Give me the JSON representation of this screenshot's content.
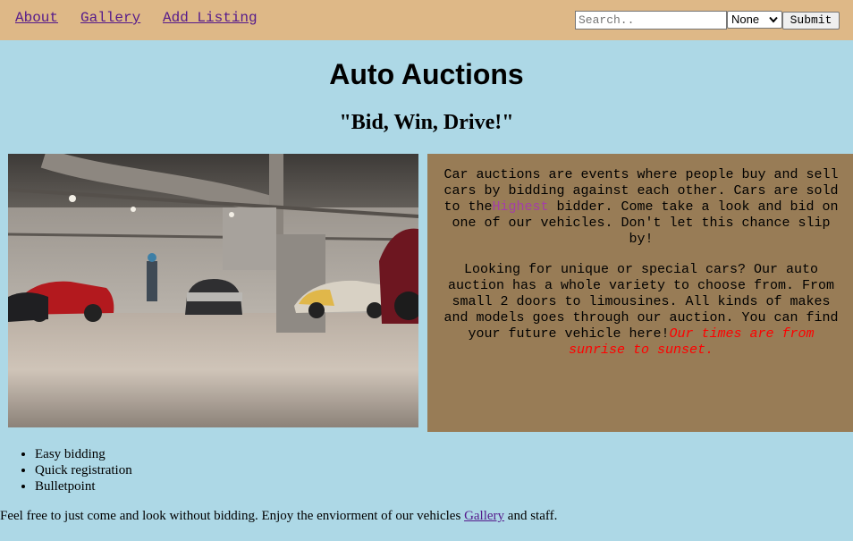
{
  "nav": {
    "links": [
      "About",
      "Gallery",
      "Add Listing"
    ],
    "search_placeholder": "Search..",
    "filter_value": "None",
    "submit_label": "Submit"
  },
  "header": {
    "title": "Auto Auctions",
    "tagline": "\"Bid, Win, Drive!\""
  },
  "hero": {
    "icon": "car-showroom-photo"
  },
  "info": {
    "p1_before": "Car auctions are events where people buy and sell cars by bidding against each other. Cars are sold to the",
    "p1_highlight": "Highest",
    "p1_after": " bidder. Come take a look and bid on one of our vehicles. Don't let this chance slip by!",
    "p2_text": "Looking for unique or special cars? Our auto auction has a whole variety to choose from. From small 2 doors to limousines. All kinds of makes and models goes through our auction. You can find your future vehicle here!",
    "p2_red": "Our times are from sunrise to sunset."
  },
  "features": [
    "Easy bidding",
    "Quick registration",
    "Bulletpoint"
  ],
  "footer": {
    "before": "Feel free to just come and look without bidding. Enjoy the enviorment of our vehicles ",
    "link": "Gallery",
    "after": " and staff."
  },
  "colors": {
    "nav_bg": "#deb887",
    "page_bg": "#add8e6",
    "info_bg": "#987c56",
    "highlight": "#a43ea8",
    "notice_red": "#ff0000"
  }
}
